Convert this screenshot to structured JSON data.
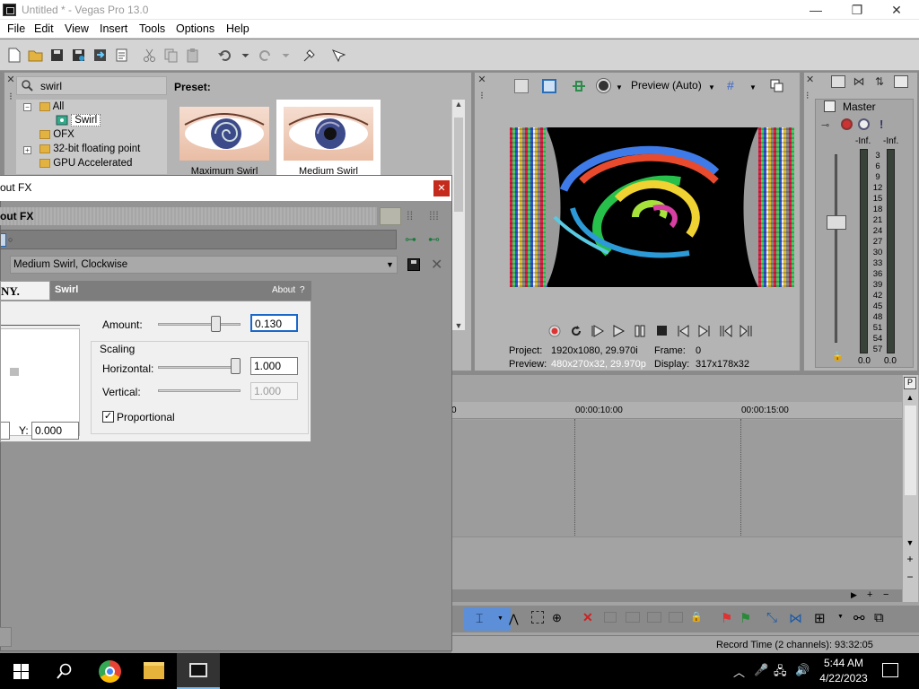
{
  "window": {
    "title": "Untitled * - Vegas Pro 13.0"
  },
  "menu": [
    "File",
    "Edit",
    "View",
    "Insert",
    "Tools",
    "Options",
    "Help"
  ],
  "explorer": {
    "search_value": "swirl",
    "tree": [
      "All",
      "Swirl",
      "OFX",
      "32-bit floating point",
      "GPU Accelerated"
    ],
    "preset_label": "Preset:",
    "presets": [
      "Maximum Swirl",
      "Medium Swirl"
    ]
  },
  "preview": {
    "mode": "Preview (Auto)",
    "project_label": "Project:",
    "project_value": "1920x1080, 29.970i",
    "frame_label": "Frame:",
    "frame_value": "0",
    "preview_label": "Preview:",
    "preview_value": "480x270x32, 29.970p",
    "display_label": "Display:",
    "display_value": "317x178x32"
  },
  "mixer": {
    "title": "Master",
    "left_label": "-Inf.",
    "right_label": "-Inf.",
    "scale": [
      "3",
      "6",
      "9",
      "12",
      "15",
      "18",
      "21",
      "24",
      "27",
      "30",
      "33",
      "36",
      "39",
      "42",
      "45",
      "48",
      "51",
      "54",
      "57"
    ],
    "left_value": "0.0",
    "right_value": "0.0"
  },
  "timeline": {
    "ticks": [
      "0",
      "00:00:10:00",
      "00:00:15:00"
    ],
    "status": "Record Time (2 channels): 93:32:05"
  },
  "fx": {
    "title": "out FX",
    "chain_label": "out FX",
    "preset_value": "Medium Swirl, Clockwise",
    "brand": "NY.",
    "plugin_name": "Swirl",
    "about": "About",
    "help": "?",
    "amount_label": "Amount:",
    "amount_value": "0.130",
    "amount_level": 0.73,
    "scaling_label": "Scaling",
    "horizontal_label": "Horizontal:",
    "horizontal_value": "1.000",
    "horizontal_level": 1.0,
    "vertical_label": "Vertical:",
    "vertical_value": "1.000",
    "proportional_label": "Proportional",
    "y_label": "Y:",
    "y_value": "0.000"
  },
  "taskbar": {
    "time": "5:44 AM",
    "date": "4/22/2023"
  }
}
